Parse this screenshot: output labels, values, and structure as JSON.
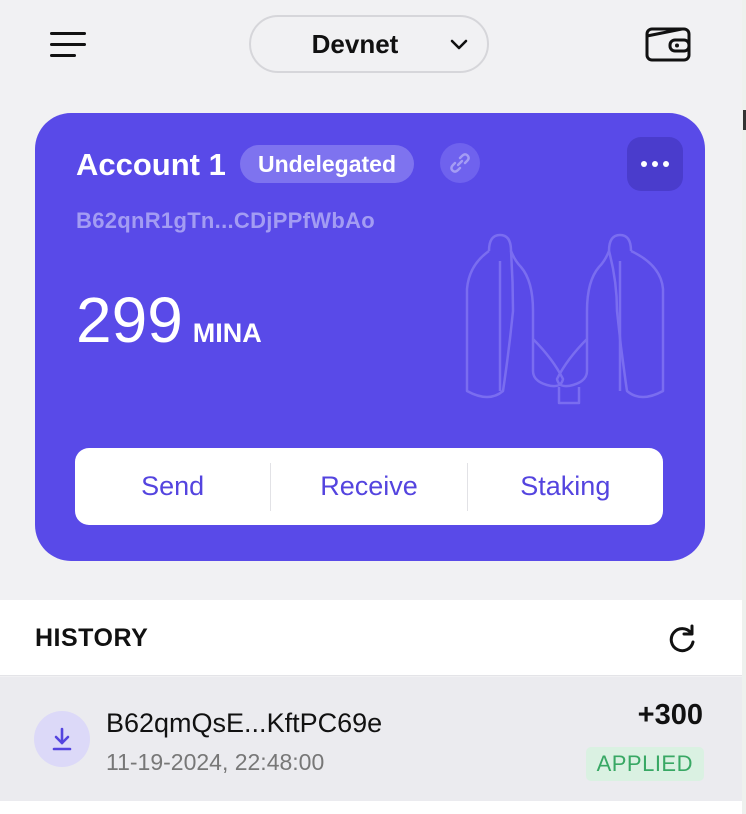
{
  "header": {
    "network": "Devnet",
    "menu_icon": "hamburger-menu-icon",
    "wallet_icon": "wallet-icon"
  },
  "account": {
    "name": "Account 1",
    "delegation_status": "Undelegated",
    "address": "B62qnR1gTn...CDjPPfWbAo",
    "balance": "299",
    "unit": "MINA",
    "actions": {
      "send": "Send",
      "receive": "Receive",
      "staking": "Staking"
    },
    "card_color": "#594ae8"
  },
  "history": {
    "title": "HISTORY",
    "transactions": [
      {
        "address": "B62qmQsE...KftPC69e",
        "timestamp": "11-19-2024, 22:48:00",
        "amount": "+300",
        "status": "APPLIED",
        "direction_icon": "download-icon"
      }
    ]
  }
}
